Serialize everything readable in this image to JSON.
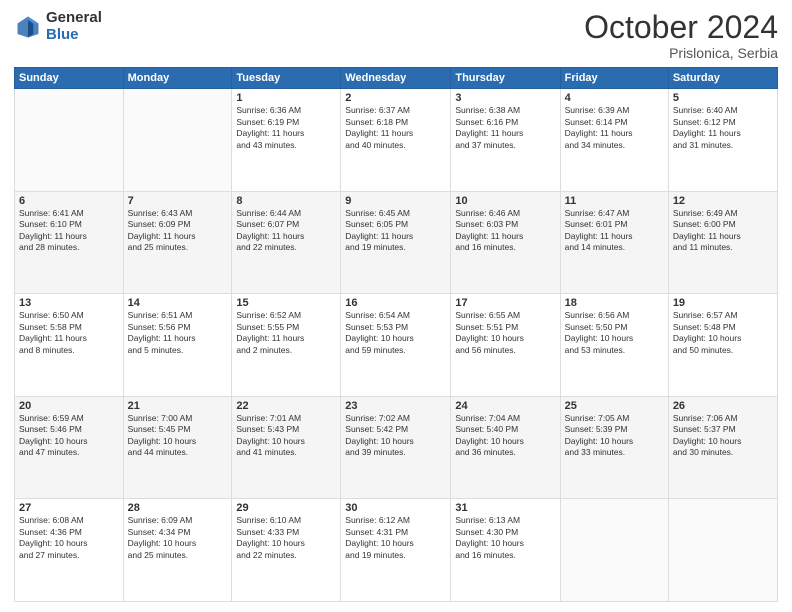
{
  "header": {
    "logo_general": "General",
    "logo_blue": "Blue",
    "month_title": "October 2024",
    "location": "Prislonica, Serbia"
  },
  "weekdays": [
    "Sunday",
    "Monday",
    "Tuesday",
    "Wednesday",
    "Thursday",
    "Friday",
    "Saturday"
  ],
  "weeks": [
    [
      {
        "day": "",
        "info": ""
      },
      {
        "day": "",
        "info": ""
      },
      {
        "day": "1",
        "info": "Sunrise: 6:36 AM\nSunset: 6:19 PM\nDaylight: 11 hours\nand 43 minutes."
      },
      {
        "day": "2",
        "info": "Sunrise: 6:37 AM\nSunset: 6:18 PM\nDaylight: 11 hours\nand 40 minutes."
      },
      {
        "day": "3",
        "info": "Sunrise: 6:38 AM\nSunset: 6:16 PM\nDaylight: 11 hours\nand 37 minutes."
      },
      {
        "day": "4",
        "info": "Sunrise: 6:39 AM\nSunset: 6:14 PM\nDaylight: 11 hours\nand 34 minutes."
      },
      {
        "day": "5",
        "info": "Sunrise: 6:40 AM\nSunset: 6:12 PM\nDaylight: 11 hours\nand 31 minutes."
      }
    ],
    [
      {
        "day": "6",
        "info": "Sunrise: 6:41 AM\nSunset: 6:10 PM\nDaylight: 11 hours\nand 28 minutes."
      },
      {
        "day": "7",
        "info": "Sunrise: 6:43 AM\nSunset: 6:09 PM\nDaylight: 11 hours\nand 25 minutes."
      },
      {
        "day": "8",
        "info": "Sunrise: 6:44 AM\nSunset: 6:07 PM\nDaylight: 11 hours\nand 22 minutes."
      },
      {
        "day": "9",
        "info": "Sunrise: 6:45 AM\nSunset: 6:05 PM\nDaylight: 11 hours\nand 19 minutes."
      },
      {
        "day": "10",
        "info": "Sunrise: 6:46 AM\nSunset: 6:03 PM\nDaylight: 11 hours\nand 16 minutes."
      },
      {
        "day": "11",
        "info": "Sunrise: 6:47 AM\nSunset: 6:01 PM\nDaylight: 11 hours\nand 14 minutes."
      },
      {
        "day": "12",
        "info": "Sunrise: 6:49 AM\nSunset: 6:00 PM\nDaylight: 11 hours\nand 11 minutes."
      }
    ],
    [
      {
        "day": "13",
        "info": "Sunrise: 6:50 AM\nSunset: 5:58 PM\nDaylight: 11 hours\nand 8 minutes."
      },
      {
        "day": "14",
        "info": "Sunrise: 6:51 AM\nSunset: 5:56 PM\nDaylight: 11 hours\nand 5 minutes."
      },
      {
        "day": "15",
        "info": "Sunrise: 6:52 AM\nSunset: 5:55 PM\nDaylight: 11 hours\nand 2 minutes."
      },
      {
        "day": "16",
        "info": "Sunrise: 6:54 AM\nSunset: 5:53 PM\nDaylight: 10 hours\nand 59 minutes."
      },
      {
        "day": "17",
        "info": "Sunrise: 6:55 AM\nSunset: 5:51 PM\nDaylight: 10 hours\nand 56 minutes."
      },
      {
        "day": "18",
        "info": "Sunrise: 6:56 AM\nSunset: 5:50 PM\nDaylight: 10 hours\nand 53 minutes."
      },
      {
        "day": "19",
        "info": "Sunrise: 6:57 AM\nSunset: 5:48 PM\nDaylight: 10 hours\nand 50 minutes."
      }
    ],
    [
      {
        "day": "20",
        "info": "Sunrise: 6:59 AM\nSunset: 5:46 PM\nDaylight: 10 hours\nand 47 minutes."
      },
      {
        "day": "21",
        "info": "Sunrise: 7:00 AM\nSunset: 5:45 PM\nDaylight: 10 hours\nand 44 minutes."
      },
      {
        "day": "22",
        "info": "Sunrise: 7:01 AM\nSunset: 5:43 PM\nDaylight: 10 hours\nand 41 minutes."
      },
      {
        "day": "23",
        "info": "Sunrise: 7:02 AM\nSunset: 5:42 PM\nDaylight: 10 hours\nand 39 minutes."
      },
      {
        "day": "24",
        "info": "Sunrise: 7:04 AM\nSunset: 5:40 PM\nDaylight: 10 hours\nand 36 minutes."
      },
      {
        "day": "25",
        "info": "Sunrise: 7:05 AM\nSunset: 5:39 PM\nDaylight: 10 hours\nand 33 minutes."
      },
      {
        "day": "26",
        "info": "Sunrise: 7:06 AM\nSunset: 5:37 PM\nDaylight: 10 hours\nand 30 minutes."
      }
    ],
    [
      {
        "day": "27",
        "info": "Sunrise: 6:08 AM\nSunset: 4:36 PM\nDaylight: 10 hours\nand 27 minutes."
      },
      {
        "day": "28",
        "info": "Sunrise: 6:09 AM\nSunset: 4:34 PM\nDaylight: 10 hours\nand 25 minutes."
      },
      {
        "day": "29",
        "info": "Sunrise: 6:10 AM\nSunset: 4:33 PM\nDaylight: 10 hours\nand 22 minutes."
      },
      {
        "day": "30",
        "info": "Sunrise: 6:12 AM\nSunset: 4:31 PM\nDaylight: 10 hours\nand 19 minutes."
      },
      {
        "day": "31",
        "info": "Sunrise: 6:13 AM\nSunset: 4:30 PM\nDaylight: 10 hours\nand 16 minutes."
      },
      {
        "day": "",
        "info": ""
      },
      {
        "day": "",
        "info": ""
      }
    ]
  ]
}
